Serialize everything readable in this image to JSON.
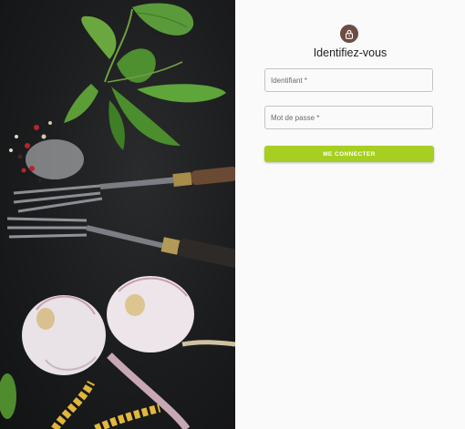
{
  "login": {
    "title": "Identifiez-vous",
    "username_placeholder": "Identifiant *",
    "username_value": "",
    "password_placeholder": "Mot de passe *",
    "password_value": "",
    "submit_label": "ME CONNECTER"
  },
  "icons": {
    "avatar": "lock-icon"
  },
  "colors": {
    "avatar_bg": "#6d4c41",
    "submit_bg": "#a6cf22",
    "panel_bg": "#fafafa"
  }
}
